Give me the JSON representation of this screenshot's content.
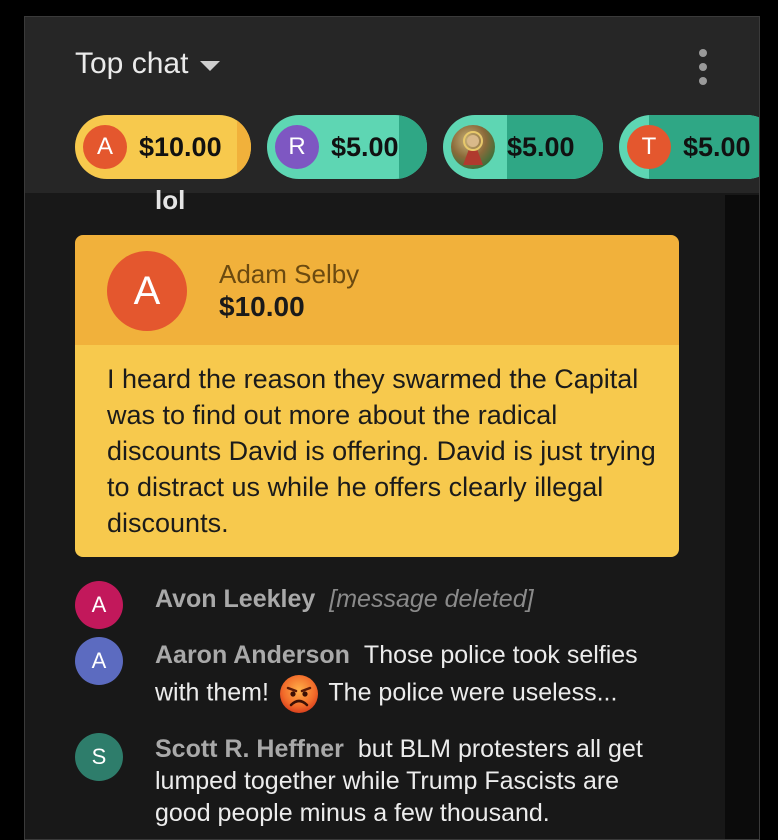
{
  "header": {
    "title": "Top chat"
  },
  "tickers": [
    {
      "initial": "A",
      "amount": "$10.00",
      "color": "#e4572e",
      "progress": 0.92
    },
    {
      "initial": "R",
      "amount": "$5.00",
      "color": "#7e57c2",
      "progress": 0.82
    },
    {
      "initial": "",
      "amount": "$5.00",
      "color": "#8e6a3c",
      "progress": 0.4
    },
    {
      "initial": "T",
      "amount": "$5.00",
      "color": "#e4572e",
      "progress": 0.19
    }
  ],
  "partial_message": {
    "text": "lol"
  },
  "superchat": {
    "initial": "A",
    "author": "Adam Selby",
    "amount": "$10.00",
    "message": "I heard the reason they swarmed the Capital was to find out more about the radical discounts David is offering. David is just trying to distract us while he offers clearly illegal discounts."
  },
  "messages": [
    {
      "initial": "A",
      "author": "Avon Leekley",
      "deleted_text": "[message deleted]",
      "color": "#c2185b"
    },
    {
      "initial": "A",
      "author": "Aaron Anderson",
      "text_before": "Those police took selfies with them!",
      "emoji": "angry-face",
      "text_after": "The police were useless...",
      "color": "#5c6bc0"
    },
    {
      "initial": "S",
      "author": "Scott R. Heffner",
      "text": "but BLM protesters all get lumped together while Trump Fascists are good people minus a few thousand.",
      "color": "#2e7d6b"
    }
  ]
}
